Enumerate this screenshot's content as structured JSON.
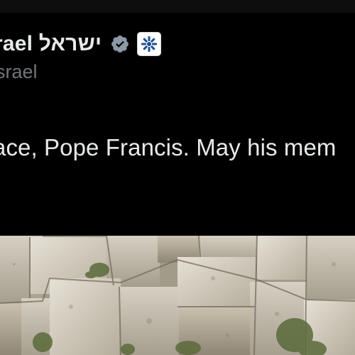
{
  "post": {
    "author": {
      "display_name": "rael ישראל",
      "handle": "srael",
      "verified_badge": "verified-badge-icon",
      "affiliate_badge": "israel-emblem-icon"
    },
    "text": "ace, Pope Francis. May his mem",
    "media": {
      "type": "photo",
      "subject": "western-wall-stones-icon"
    }
  },
  "colors": {
    "background": "#000000",
    "text_primary": "#e7e9ea",
    "text_secondary": "#71767b",
    "verified_blue": "#8b98a5",
    "emblem_blue": "#1d4f91"
  }
}
